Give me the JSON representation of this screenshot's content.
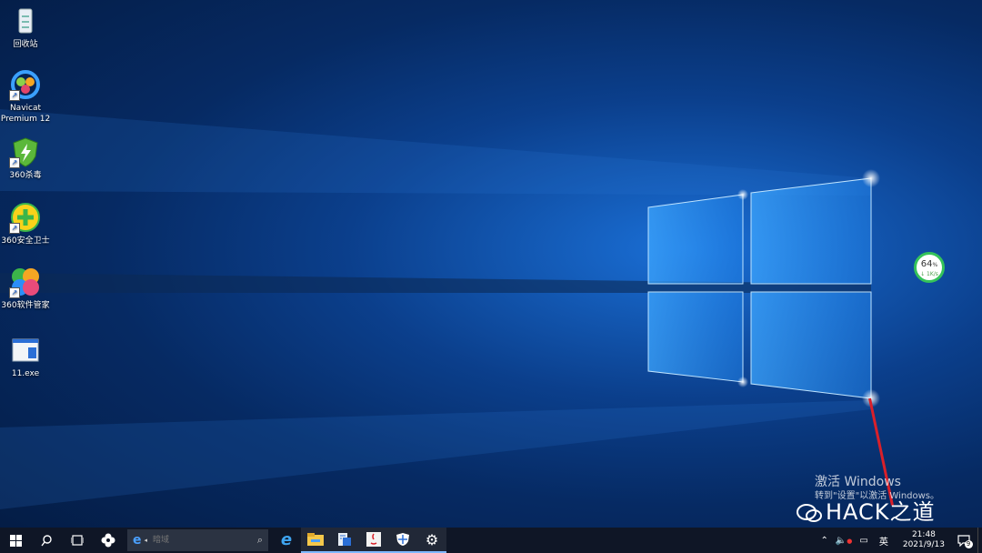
{
  "desktop": {
    "icons": [
      {
        "label_lines": [
          "回收站"
        ]
      },
      {
        "label_lines": [
          "Navicat",
          "Premium 12"
        ]
      },
      {
        "label_lines": [
          "360杀毒"
        ]
      },
      {
        "label_lines": [
          "360安全卫士"
        ]
      },
      {
        "label_lines": [
          "360软件管家"
        ]
      },
      {
        "label_lines": [
          "11.exe"
        ]
      }
    ]
  },
  "widget": {
    "percent": "64",
    "unit": "%",
    "speed": "↓ 1K/s",
    "accent": "#35c35a"
  },
  "activation": {
    "title": "激活 Windows",
    "subtitle": "转到\"设置\"以激活 Windows。"
  },
  "watermark": {
    "text": "HACK之道"
  },
  "taskbar": {
    "search_placeholder": "暗域",
    "apps": [
      "ie-icon",
      "file-explorer-icon",
      "task-manager-icon",
      "java-app-icon",
      "defender-shield-icon",
      "settings-gear-icon"
    ],
    "input_method": "英",
    "time": "21:48",
    "date": "2021/9/13",
    "notification_count": "9"
  },
  "colors": {
    "accent_red": "#d9202a",
    "taskbar_bg": "#0f1626"
  }
}
